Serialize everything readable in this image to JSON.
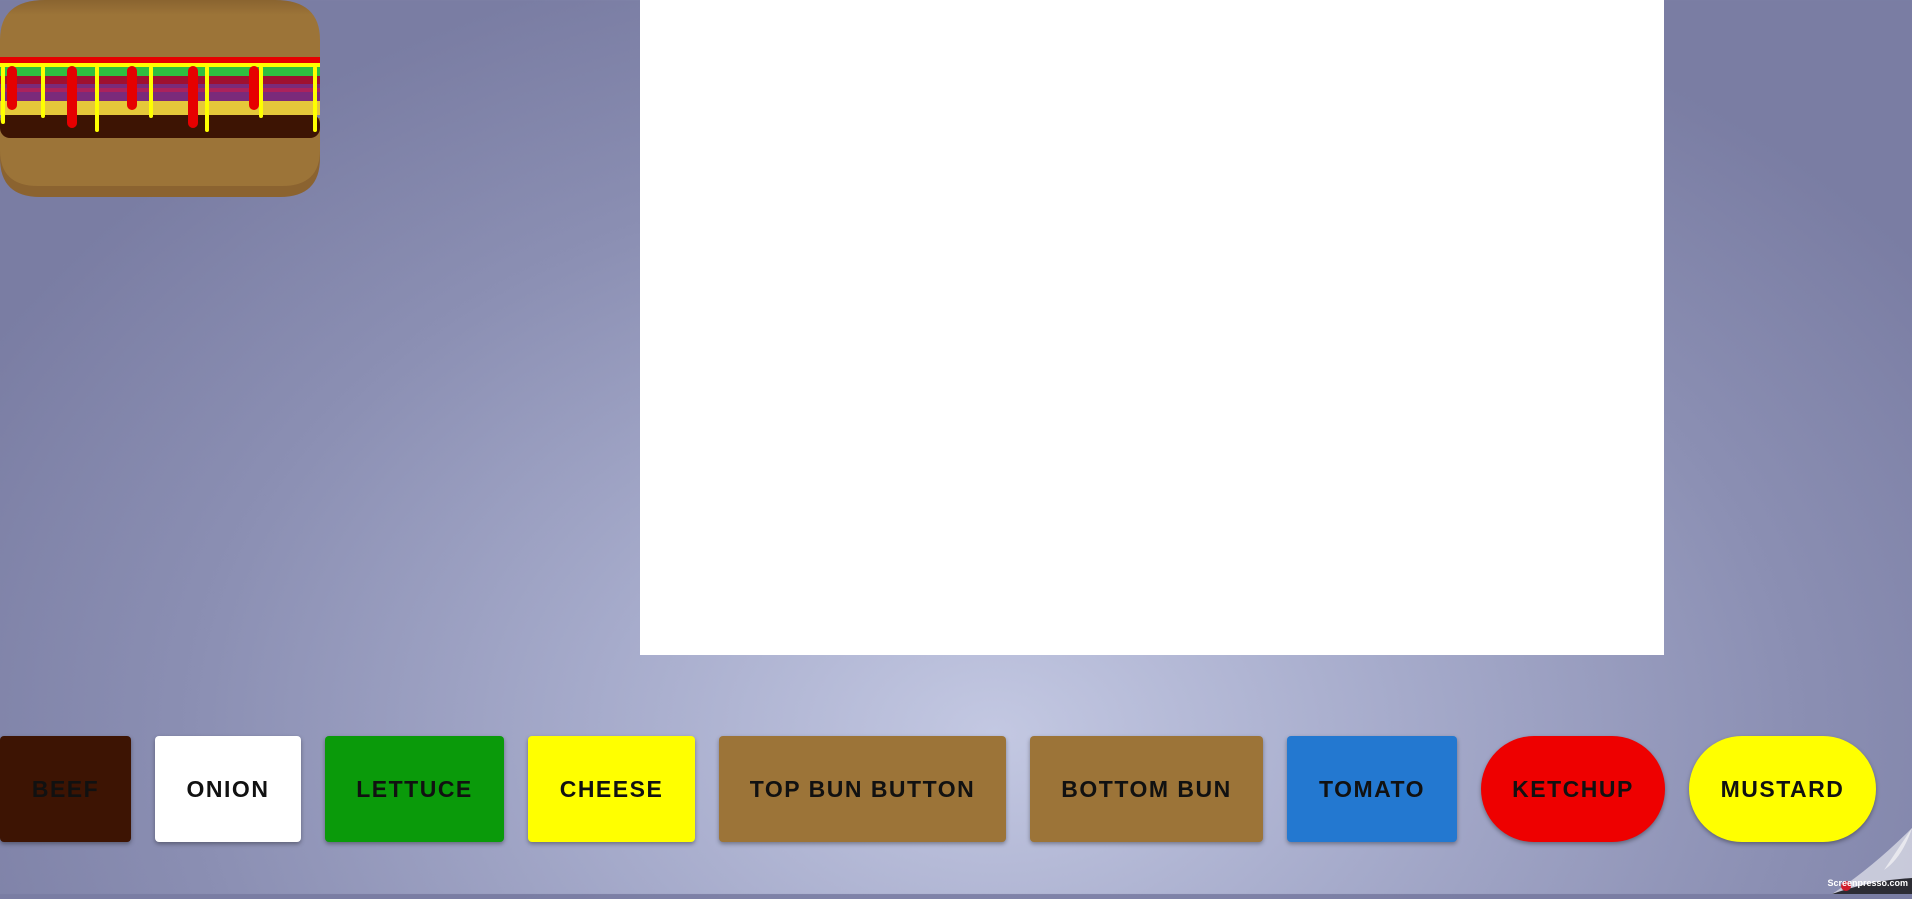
{
  "ingredients": [
    {
      "label": "BEEF",
      "color": "#3d1403"
    },
    {
      "label": "ONION",
      "color": "#ffffff"
    },
    {
      "label": "LETTUCE",
      "color": "#0a9a0a"
    },
    {
      "label": "CHEESE",
      "color": "#ffff00"
    },
    {
      "label": "TOP BUN BUTTON",
      "color": "#9c7438"
    },
    {
      "label": "BOTTOM BUN",
      "color": "#9c7438"
    },
    {
      "label": "TOMATO",
      "color": "#2378d0"
    },
    {
      "label": "KETCHUP",
      "color": "#ee0000"
    },
    {
      "label": "MUSTARD",
      "color": "#ffff00"
    }
  ],
  "burger_preview": {
    "bun_color": "#9c7438",
    "patty_color": "#3d1403",
    "lettuce_color": "#2fbf40",
    "cheese_color": "#e5c83a",
    "ketchup_color": "#e60000",
    "mustard_color": "#ffff00"
  },
  "watermark": {
    "text": "Screenpresso.com"
  }
}
